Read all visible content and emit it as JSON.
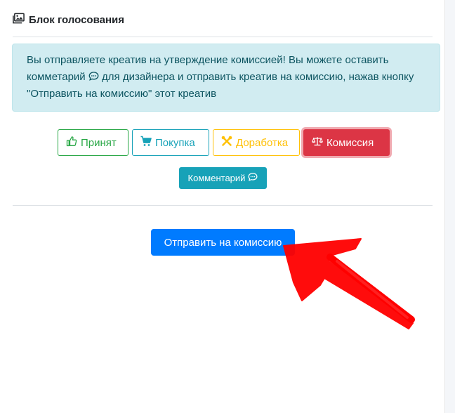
{
  "header": {
    "title": "Блок голосования",
    "icon": "images-icon"
  },
  "alert": {
    "text_part1": "Вы отправляете креатив на утверждение комиссией! Вы можете оставить комметарий",
    "text_part2": "для дизайнера и отправить креатив на комиссию, нажав кнопку \"Отправить на комиссию\" этот креатив",
    "icon": "comment-dots-icon",
    "bg_color": "#d1ecf1",
    "text_color": "#0c5460"
  },
  "vote_buttons": {
    "accept": {
      "label": "Принят",
      "icon": "thumbs-up-icon",
      "color": "#28a745"
    },
    "buy": {
      "label": "Покупка",
      "icon": "cart-icon",
      "color": "#17a2b8"
    },
    "rework": {
      "label": "Доработка",
      "icon": "tools-icon",
      "color": "#ffc107"
    },
    "commission": {
      "label": "Комиссия",
      "icon": "balance-scale-icon",
      "color": "#dc3545",
      "state": "selected"
    }
  },
  "comment_button": {
    "label": "Комментарий",
    "icon": "comment-dots-icon",
    "color": "#17a2b8"
  },
  "send_button": {
    "label": "Отправить на комиссию",
    "color": "#007bff"
  },
  "annotation": {
    "type": "arrow",
    "color": "#ff0000"
  }
}
